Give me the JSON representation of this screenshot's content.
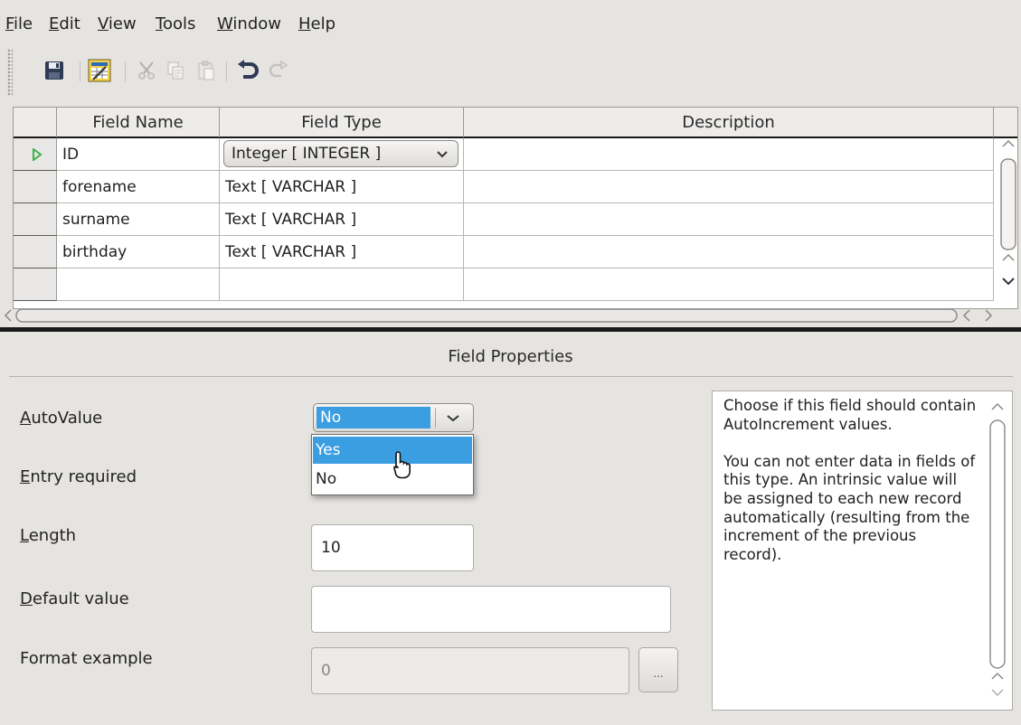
{
  "menu": [
    {
      "label": "File",
      "mnemonic": "F",
      "rest": "ile"
    },
    {
      "label": "Edit",
      "mnemonic": "E",
      "rest": "dit"
    },
    {
      "label": "View",
      "mnemonic": "V",
      "rest": "iew"
    },
    {
      "label": "Tools",
      "mnemonic": "T",
      "rest": "ools"
    },
    {
      "label": "Window",
      "mnemonic": "W",
      "rest": "indow"
    },
    {
      "label": "Help",
      "mnemonic": "H",
      "rest": "elp"
    }
  ],
  "toolbar": {
    "buttons": [
      "save-icon",
      "table-design-icon",
      "cut-icon",
      "copy-icon",
      "paste-icon",
      "undo-icon",
      "redo-icon"
    ]
  },
  "table": {
    "headers": [
      "Field Name",
      "Field Type",
      "Description"
    ],
    "rows": [
      {
        "name": "ID",
        "type": "Integer [ INTEGER ]",
        "description": "",
        "current": true
      },
      {
        "name": "forename",
        "type": "Text [ VARCHAR ]",
        "description": ""
      },
      {
        "name": "surname",
        "type": "Text [ VARCHAR ]",
        "description": ""
      },
      {
        "name": "birthday",
        "type": "Text [ VARCHAR ]",
        "description": ""
      },
      {
        "name": "",
        "type": "",
        "description": ""
      }
    ]
  },
  "properties": {
    "title": "Field Properties",
    "autovalue": {
      "mnemonic": "A",
      "rest": "utoValue",
      "value": "No",
      "options": [
        "Yes",
        "No"
      ],
      "highlighted": "Yes"
    },
    "entry_required": {
      "mnemonic": "E",
      "rest": "ntry required"
    },
    "length": {
      "mnemonic": "L",
      "rest": "ength",
      "value": "10"
    },
    "default_value": {
      "mnemonic": "D",
      "rest": "efault value",
      "value": ""
    },
    "format_example": {
      "label": "Format example",
      "value": "0",
      "button": "..."
    },
    "help_text": "Choose if this field should contain AutoIncrement values.\n\nYou can not enter data in fields of this type. An intrinsic value will be assigned to each new record automatically (resulting from the increment of the previous record)."
  },
  "colors": {
    "accent": "#3a9ee0",
    "current_row_marker": "#3bb34a"
  }
}
